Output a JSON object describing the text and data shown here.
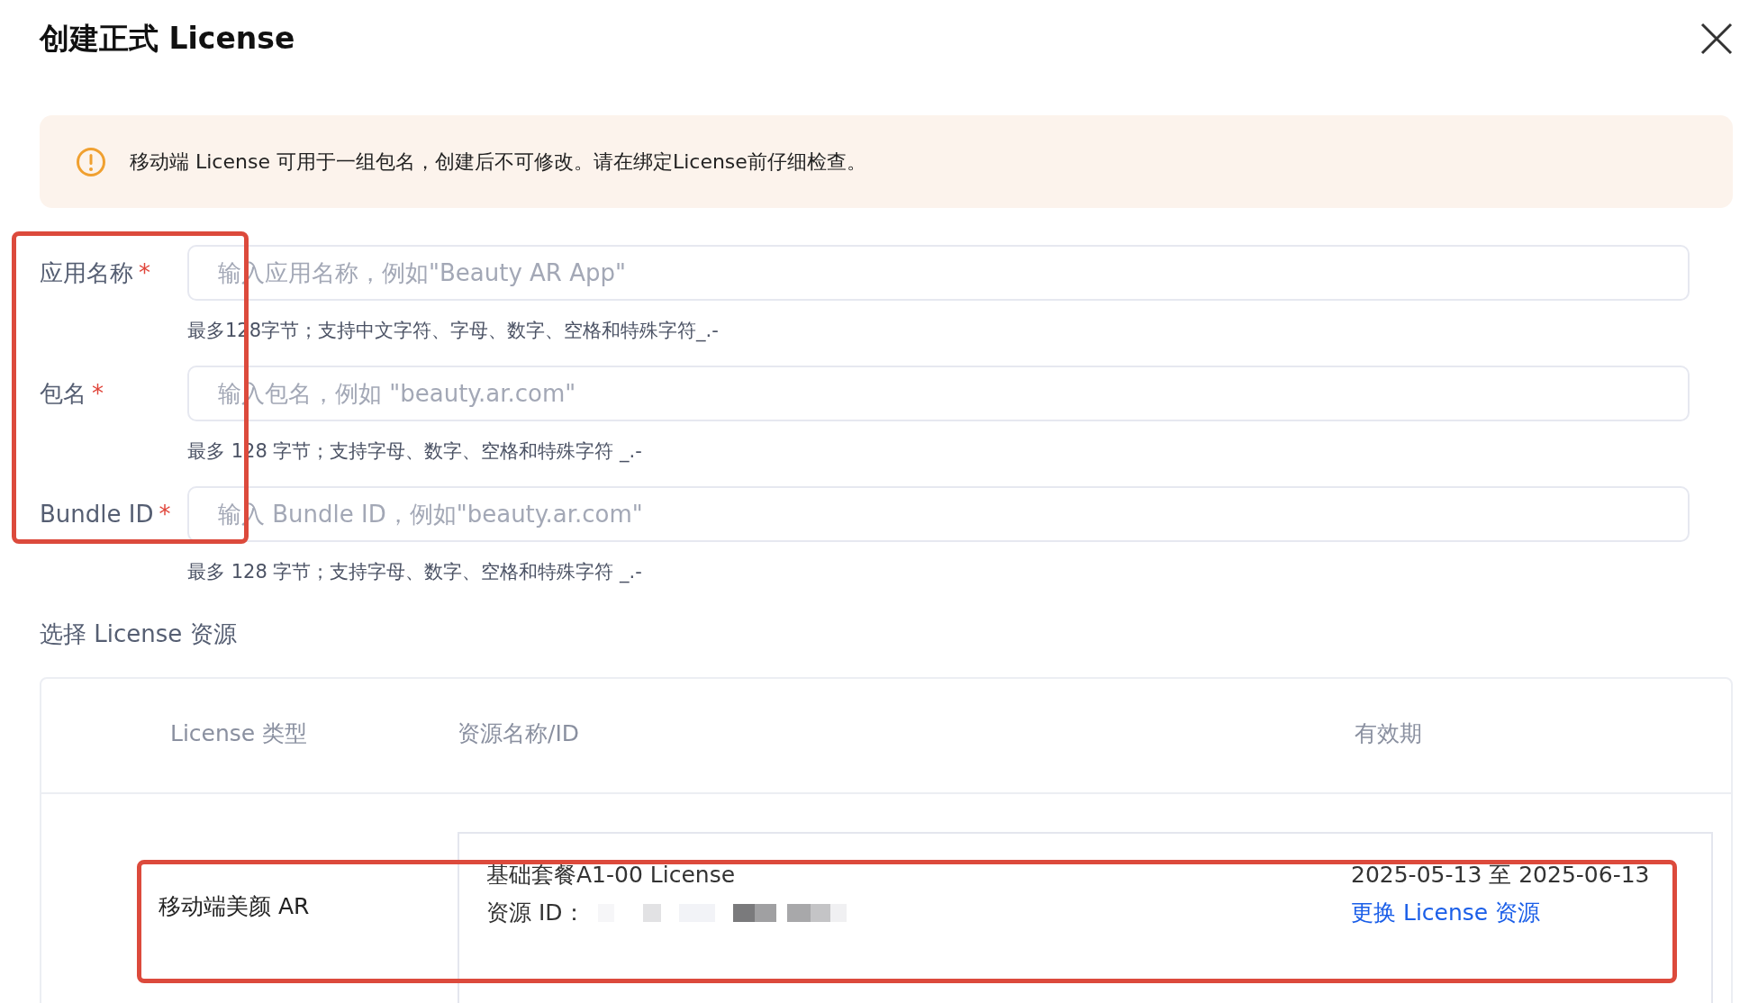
{
  "dialog": {
    "title": "创建正式 License"
  },
  "alert": {
    "text": "移动端 License 可用于一组包名，创建后不可修改。请在绑定License前仔细检查。"
  },
  "fields": [
    {
      "label": "应用名称",
      "required_mark": "*",
      "placeholder": "输入应用名称，例如\"Beauty AR App\"",
      "help": "最多128字节；支持中文字符、字母、数字、空格和特殊字符_.-"
    },
    {
      "label": "包名",
      "required_mark": "*",
      "placeholder": "输入包名，例如 \"beauty.ar.com\"",
      "help": "最多 128 字节；支持字母、数字、空格和特殊字符 _.-"
    },
    {
      "label": "Bundle ID",
      "required_mark": "*",
      "placeholder": "输入 Bundle ID，例如\"beauty.ar.com\"",
      "help": "最多 128 字节；支持字母、数字、空格和特殊字符 _.-"
    }
  ],
  "section_title": "选择 License 资源",
  "table": {
    "columns": [
      "License 类型",
      "资源名称/ID",
      "有效期"
    ],
    "rows": [
      {
        "type": "移动端美颜 AR",
        "resource_name": "基础套餐A1-00 License",
        "resource_id_label": "资源 ID：",
        "validity": "2025-05-13 至 2025-06-13",
        "action": "更换 License 资源"
      }
    ]
  }
}
